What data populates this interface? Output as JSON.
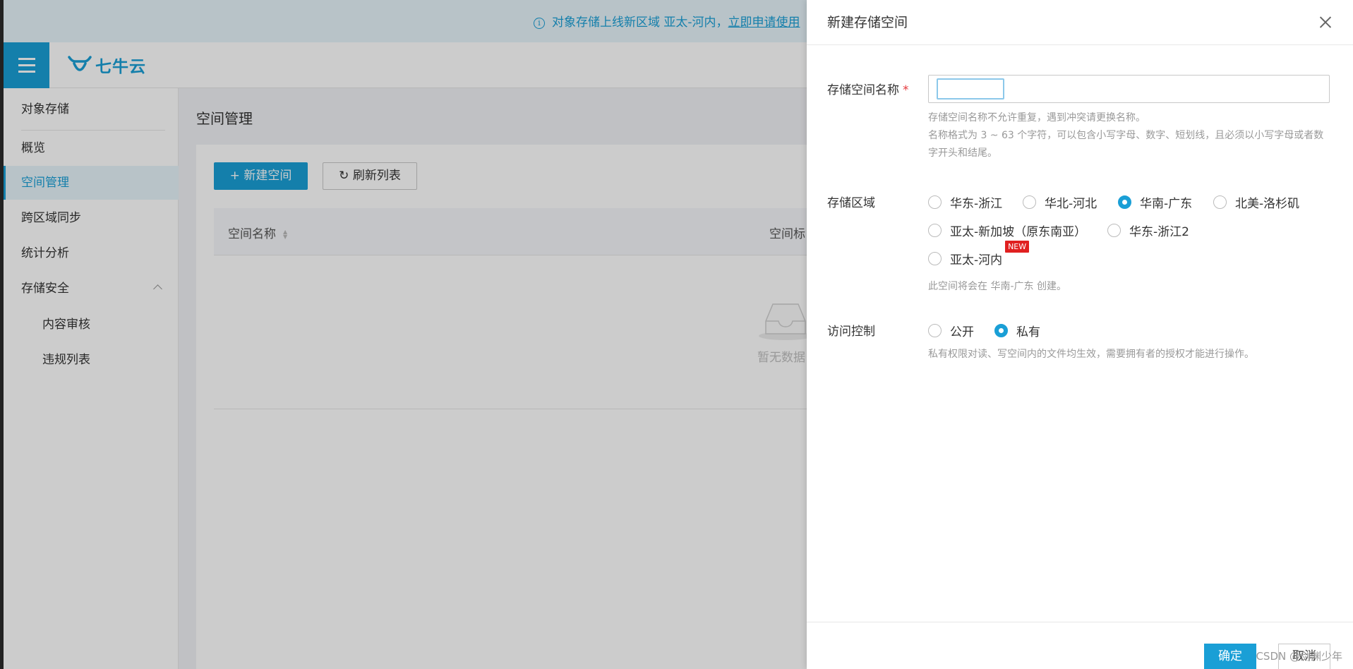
{
  "banner": {
    "text": "对象存储上线新区域 亚太-河内，",
    "link": "立即申请使用",
    "icon": "info-icon"
  },
  "header": {
    "logo_text": "七牛云",
    "menu_icon": "hamburger-icon"
  },
  "sidebar": {
    "items": [
      {
        "label": "对象存储"
      },
      {
        "label": "概览"
      },
      {
        "label": "空间管理"
      },
      {
        "label": "跨区域同步"
      },
      {
        "label": "统计分析"
      },
      {
        "label": "存储安全"
      },
      {
        "label": "内容审核"
      },
      {
        "label": "违规列表"
      }
    ],
    "active": "空间管理"
  },
  "main": {
    "title": "空间管理",
    "new_button": "+ 新建空间",
    "refresh_button": "刷新列表",
    "table": {
      "columns": [
        "空间名称",
        "空间标"
      ],
      "empty_text": "暂无数据"
    }
  },
  "drawer": {
    "title": "新建存储空间",
    "name_label": "存储空间名称",
    "name_required": "*",
    "name_value": "",
    "name_hint_1": "存储空间名称不允许重复，遇到冲突请更换名称。",
    "name_hint_2": "名称格式为 3 ~ 63 个字符，可以包含小写字母、数字、短划线，且必须以小写字母或者数字开头和结尾。",
    "region_label": "存储区域",
    "regions": [
      {
        "label": "华东-浙江",
        "checked": false
      },
      {
        "label": "华北-河北",
        "checked": false
      },
      {
        "label": "华南-广东",
        "checked": true
      },
      {
        "label": "北美-洛杉矶",
        "checked": false
      },
      {
        "label": "亚太-新加坡（原东南亚）",
        "checked": false
      },
      {
        "label": "华东-浙江2",
        "checked": false
      },
      {
        "label": "亚太-河内",
        "checked": false,
        "badge": "NEW"
      }
    ],
    "region_hint": "此空间将会在 华南-广东 创建。",
    "access_label": "访问控制",
    "access_options": [
      {
        "label": "公开",
        "checked": false
      },
      {
        "label": "私有",
        "checked": true
      }
    ],
    "access_hint": "私有权限对读、写空间内的文件均生效，需要拥有者的授权才能进行操作。",
    "ok_button": "确定",
    "cancel_button": "取消"
  },
  "watermark": "CSDN @剑渊少年",
  "colors": {
    "accent": "#1a9fd6",
    "danger": "#e02020"
  }
}
